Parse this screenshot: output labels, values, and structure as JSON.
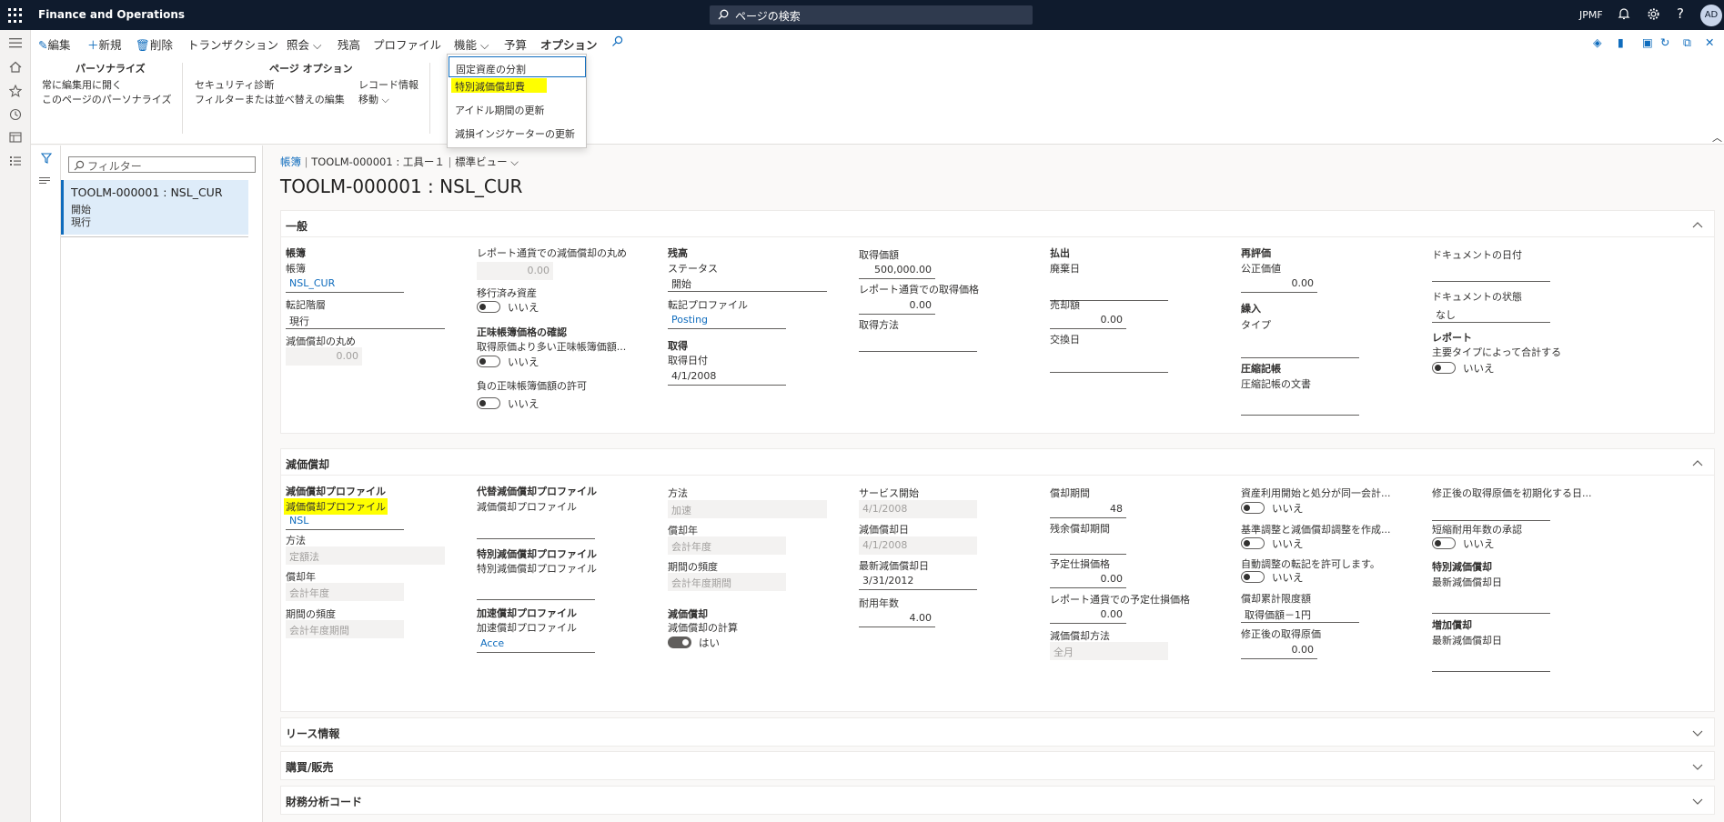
{
  "app": {
    "title": "Finance and Operations",
    "search_placeholder": "ページの検索",
    "company": "JPMF",
    "avatar": "AD"
  },
  "commands": {
    "edit": "編集",
    "new": "新規",
    "delete": "削除",
    "transactions": "トランザクション",
    "inquiry": "照会",
    "ledger_sep": "残高",
    "profile": "プロファイル",
    "functions": "機能",
    "budget": "予算",
    "options": "オプション"
  },
  "ribbon": {
    "personalize_title": "パーソナライズ",
    "always_edit": "常に編集用に開く",
    "personalize_page": "このページのパーソナライズ",
    "page_options_title": "ページ オプション",
    "security": "セキュリティ診断",
    "filter_edit": "フィルターまたは並べ替えの編集",
    "record_info": "レコード情報",
    "move": "移動"
  },
  "menu": {
    "items": [
      "固定資産の分割",
      "特別減価償却費",
      "アイドル期間の更新",
      "減損インジケーターの更新"
    ]
  },
  "filter": {
    "placeholder": "フィルター",
    "item_title": "TOOLM-000001 : NSL_CUR",
    "item_line2": "開始",
    "item_line3": "現行"
  },
  "breadcrumb": {
    "root": "帳簿",
    "record": "TOOLM-000001 : 工具ー１",
    "view": "標準ビュー"
  },
  "page_title": "TOOLM-000001 : NSL_CUR",
  "general": {
    "header": "一般",
    "book_group": "帳簿",
    "book_label": "帳簿",
    "book_value": "NSL_CUR",
    "posting_layer_label": "転記階層",
    "posting_layer_value": "現行",
    "dep_rounding_label": "減価償却の丸め",
    "dep_rounding_value": "0.00",
    "rep_rounding_label": "レポート通貨での減価償却の丸め",
    "rep_rounding_value": "0.00",
    "migrated_label": "移行済み資産",
    "migrated_value": "いいえ",
    "confirm_title": "正味帳簿価格の確認",
    "acq_more_label": "取得原価より多い正味帳簿価額...",
    "acq_more_value": "いいえ",
    "neg_label": "負の正味帳簿価額の許可",
    "neg_value": "いいえ",
    "balance_title": "残高",
    "status_label": "ステータス",
    "status_value": "開始",
    "post_profile_label": "転記プロファイル",
    "post_profile_value": "Posting",
    "acq_title": "取得",
    "acq_date_label": "取得日付",
    "acq_date_value": "4/1/2008",
    "acq_price_label": "取得価額",
    "acq_price_value": "500,000.00",
    "rep_acq_label": "レポート通貨での取得価格",
    "rep_acq_value": "0.00",
    "acq_method_label": "取得方法",
    "acq_method_value": "",
    "disposal_title": "払出",
    "scrap_date_label": "廃棄日",
    "scrap_date_value": "",
    "sale_label": "売却額",
    "sale_value": "0.00",
    "exchange_label": "交換日",
    "exchange_value": "",
    "reval_title": "再評価",
    "fair_label": "公正価値",
    "fair_value": "0.00",
    "transfer_title": "繰入",
    "type_label": "タイプ",
    "type_value": "",
    "comp_title": "圧縮記帳",
    "comp_doc_label": "圧縮記帳の文書",
    "comp_doc_value": "",
    "doc_date_label": "ドキュメントの日付",
    "doc_date_value": "",
    "doc_status_label": "ドキュメントの状態",
    "doc_status_value": "なし",
    "report_title": "レポート",
    "sum_label": "主要タイプによって合計する",
    "sum_value": "いいえ"
  },
  "depreciation": {
    "header": "減価償却",
    "profile_title": "減価償却プロファイル",
    "profile_label": "減価償却プロファイル",
    "profile_value": "NSL",
    "method_label": "方法",
    "method_value": "定額法",
    "year_label": "償却年",
    "year_value": "会計年度",
    "freq_label": "期間の頻度",
    "freq_value": "会計年度期間",
    "alt_title": "代替減価償却プロファイル",
    "alt_label": "減価償却プロファイル",
    "alt_value": "",
    "special_title": "特別減価償却プロファイル",
    "special_label": "特別減価償却プロファイル",
    "special_value": "",
    "accel_title": "加速償却プロファイル",
    "accel_label": "加速償却プロファイル",
    "accel_value": "Acce",
    "m2_label": "方法",
    "m2_value": "加速",
    "y2_label": "償却年",
    "y2_value": "会計年度",
    "f2_label": "期間の頻度",
    "f2_value": "会計年度期間",
    "dep_title": "減価償却",
    "calc_label": "減価償却の計算",
    "calc_value": "はい",
    "svc_label": "サービス開始",
    "svc_value": "4/1/2008",
    "dep_date_label": "減価償却日",
    "dep_date_value": "4/1/2008",
    "last_dep_label": "最新減価償却日",
    "last_dep_value": "3/31/2012",
    "life_label": "耐用年数",
    "life_value": "4.00",
    "periods_label": "償却期間",
    "periods_value": "48",
    "remain_label": "残余償却期間",
    "remain_value": "",
    "scrap_label": "予定仕損価格",
    "scrap_value": "0.00",
    "rep_scrap_label": "レポート通貨での予定仕損価格",
    "rep_scrap_value": "0.00",
    "conv_label": "減価償却方法",
    "conv_value": "全月",
    "same_year_label": "資産利用開始と処分が同一会計...",
    "same_year_value": "いいえ",
    "adj_label": "基準調整と減価償却調整を作成...",
    "adj_value": "いいえ",
    "auto_label": "自動調整の転記を許可します。",
    "auto_value": "いいえ",
    "limit_label": "償却累計限度額",
    "limit_value": "取得価額－1円",
    "rev_acq_label": "修正後の取得原価",
    "rev_acq_value": "0.00",
    "init_label": "修正後の取得原価を初期化する日...",
    "init_value": "",
    "short_label": "短縮耐用年数の承認",
    "short_value": "いいえ",
    "sp_title": "特別減価償却",
    "sp_last_label": "最新減価償却日",
    "sp_last_value": "",
    "bonus_title": "増加償却",
    "bonus_last_label": "最新減価償却日",
    "bonus_last_value": ""
  },
  "sections": {
    "lease": "リース情報",
    "purchase": "購買/販売",
    "financial": "財務分析コード"
  },
  "colors": {
    "accent": "#0f6cbd",
    "highlight": "#ffff00",
    "topbar": "#0f1b2d"
  }
}
